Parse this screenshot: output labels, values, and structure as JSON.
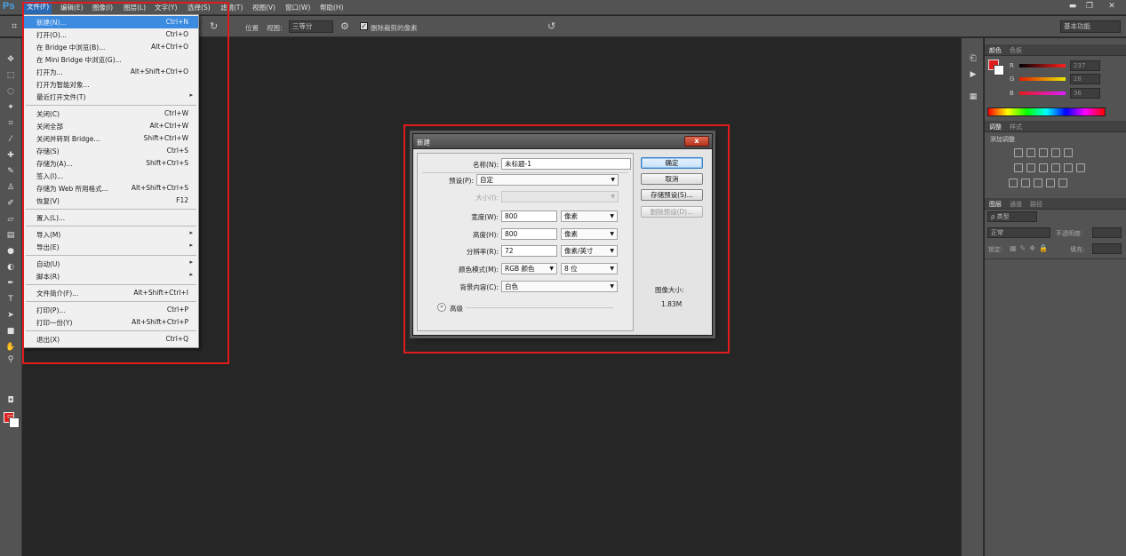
{
  "app": {
    "logo": "Ps"
  },
  "menubar": {
    "items": [
      "文件(F)",
      "编辑(E)",
      "图像(I)",
      "图层(L)",
      "文字(Y)",
      "选择(S)",
      "滤镜(T)",
      "视图(V)",
      "窗口(W)",
      "帮助(H)"
    ],
    "window_controls": [
      "▬",
      "❐",
      "✕"
    ]
  },
  "options_bar": {
    "position_label": "位置",
    "view_label": "视图:",
    "view_value": "三等分",
    "delete_crop_label": "删除裁剪的像素",
    "workspace_value": "基本功能"
  },
  "file_menu": {
    "items": [
      {
        "label": "新建(N)...",
        "shortcut": "Ctrl+N",
        "highlighted": true
      },
      {
        "label": "打开(O)...",
        "shortcut": "Ctrl+O"
      },
      {
        "label": "在 Bridge 中浏览(B)...",
        "shortcut": "Alt+Ctrl+O"
      },
      {
        "label": "在 Mini Bridge 中浏览(G)...",
        "shortcut": ""
      },
      {
        "label": "打开为...",
        "shortcut": "Alt+Shift+Ctrl+O"
      },
      {
        "label": "打开为智能对象...",
        "shortcut": ""
      },
      {
        "label": "最近打开文件(T)",
        "shortcut": "",
        "submenu": true
      },
      {
        "separator": true
      },
      {
        "label": "关闭(C)",
        "shortcut": "Ctrl+W"
      },
      {
        "label": "关闭全部",
        "shortcut": "Alt+Ctrl+W"
      },
      {
        "label": "关闭并转到 Bridge...",
        "shortcut": "Shift+Ctrl+W"
      },
      {
        "label": "存储(S)",
        "shortcut": "Ctrl+S"
      },
      {
        "label": "存储为(A)...",
        "shortcut": "Shift+Ctrl+S"
      },
      {
        "label": "签入(I)...",
        "shortcut": ""
      },
      {
        "label": "存储为 Web 所用格式...",
        "shortcut": "Alt+Shift+Ctrl+S"
      },
      {
        "label": "恢复(V)",
        "shortcut": "F12"
      },
      {
        "separator": true
      },
      {
        "label": "置入(L)...",
        "shortcut": ""
      },
      {
        "separator": true
      },
      {
        "label": "导入(M)",
        "shortcut": "",
        "submenu": true
      },
      {
        "label": "导出(E)",
        "shortcut": "",
        "submenu": true
      },
      {
        "separator": true
      },
      {
        "label": "自动(U)",
        "shortcut": "",
        "submenu": true
      },
      {
        "label": "脚本(R)",
        "shortcut": "",
        "submenu": true
      },
      {
        "separator": true
      },
      {
        "label": "文件简介(F)...",
        "shortcut": "Alt+Shift+Ctrl+I"
      },
      {
        "separator": true
      },
      {
        "label": "打印(P)...",
        "shortcut": "Ctrl+P"
      },
      {
        "label": "打印一份(Y)",
        "shortcut": "Alt+Shift+Ctrl+P"
      },
      {
        "separator": true
      },
      {
        "label": "退出(X)",
        "shortcut": "Ctrl+Q"
      }
    ]
  },
  "color_panel": {
    "tabs": [
      "颜色",
      "色板"
    ],
    "channels": [
      {
        "label": "R",
        "value": "237",
        "gradient": "linear-gradient(to right,#000,#ff2020)"
      },
      {
        "label": "G",
        "value": "28",
        "gradient": "linear-gradient(to right,#e01c00,#e8e800)"
      },
      {
        "label": "B",
        "value": "36",
        "gradient": "linear-gradient(to right,#e01c1c,#e01cff)"
      }
    ]
  },
  "adjust_panel": {
    "tabs": [
      "调整",
      "样式"
    ],
    "subtitle": "添加调整"
  },
  "layers_panel": {
    "tabs": [
      "图层",
      "通道",
      "路径"
    ],
    "kind_label": "ρ 类型",
    "blend_mode": "正常",
    "opacity_label": "不透明度:",
    "lock_label": "锁定:",
    "fill_label": "填充:"
  },
  "dialog": {
    "title": "新建",
    "close": "x",
    "name_label": "名称(N):",
    "name_value": "未标题-1",
    "preset_label": "预设(P):",
    "preset_value": "自定",
    "size_label": "大小(I):",
    "width_label": "宽度(W):",
    "width_value": "800",
    "width_unit": "像素",
    "height_label": "高度(H):",
    "height_value": "800",
    "height_unit": "像素",
    "resolution_label": "分辨率(R):",
    "resolution_value": "72",
    "resolution_unit": "像素/英寸",
    "colormode_label": "颜色模式(M):",
    "colormode_value": "RGB 颜色",
    "bitdepth_value": "8 位",
    "bg_label": "背景内容(C):",
    "bg_value": "白色",
    "advanced_label": "高级",
    "ok": "确定",
    "cancel": "取消",
    "save_preset": "存储预设(S)...",
    "delete_preset": "删除预设(D)...",
    "image_size_label": "图像大小:",
    "image_size_value": "1.83M"
  },
  "colors": {
    "highlight": "#e01b1b",
    "accent": "#3b8be0"
  }
}
